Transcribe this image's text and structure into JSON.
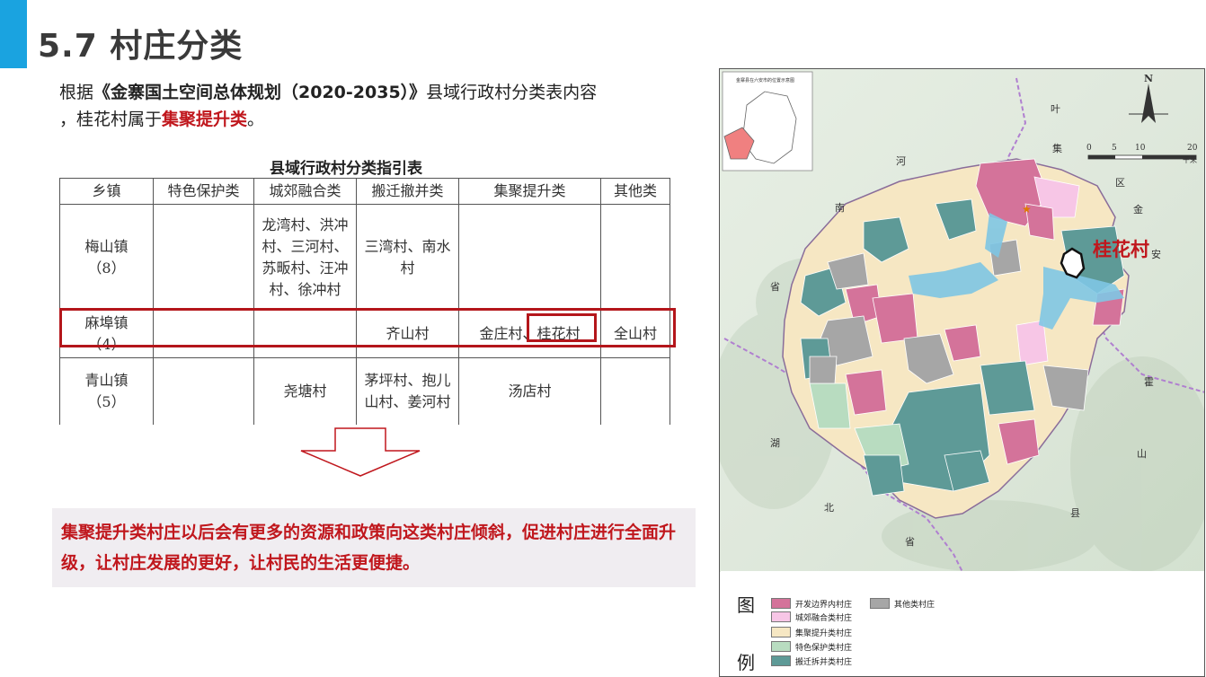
{
  "header": {
    "title": "5.7 村庄分类"
  },
  "intro": {
    "prefix": "根据",
    "doc_title": "《金寨国土空间总体规划（2020-2035）》",
    "suffix": "县域行政村分类表内容",
    "line2_prefix": "，桂花村属于",
    "line2_highlight": "集聚提升类",
    "line2_suffix": "。"
  },
  "table": {
    "title": "县域行政村分类指引表",
    "columns": [
      "乡镇",
      "特色保护类",
      "城郊融合类",
      "搬迁撤并类",
      "集聚提升类",
      "其他类"
    ],
    "rows": [
      {
        "town": "梅山镇\n（8）",
        "special": "",
        "suburban": "龙湾村、洪冲村、三河村、苏畈村、汪冲村、徐冲村",
        "relocate": "三湾村、南水村",
        "cluster": "",
        "other": ""
      },
      {
        "town": "麻埠镇\n（4）",
        "special": "",
        "suburban": "",
        "relocate": "齐山村",
        "cluster": "金庄村、桂花村",
        "other": "全山村"
      },
      {
        "town": "青山镇\n（5）",
        "special": "",
        "suburban": "尧塘村",
        "relocate": "茅坪村、抱儿山村、姜河村",
        "cluster": "汤店村",
        "other": ""
      }
    ]
  },
  "conclusion": "集聚提升类村庄以后会有更多的资源和政策向这类村庄倾斜，促进村庄进行全面升级，让村庄发展的更好，让村民的生活更便捷。",
  "map": {
    "highlight_label": "桂花村",
    "inset_title": "金寨县在六安市的位置示意图",
    "north": "N",
    "scale": {
      "ticks": [
        "0",
        "5",
        "10",
        "20"
      ],
      "unit": "千米"
    },
    "place_labels": {
      "ye": "叶",
      "ji": "集",
      "qu": "区",
      "jin": "金",
      "an": "安",
      "he": "河",
      "nan": "南",
      "sheng1": "省",
      "hu": "湖",
      "bei": "北",
      "sheng2": "省",
      "huo": "霍",
      "shan": "山",
      "xian": "县"
    }
  },
  "legend": {
    "title_1": "图",
    "title_2": "例",
    "items": [
      {
        "label": "开发边界内村庄",
        "color": "#d4739a"
      },
      {
        "label": "城郊融合类村庄",
        "color": "#f7c6e6"
      },
      {
        "label": "集聚提升类村庄",
        "color": "#f6e7c3"
      },
      {
        "label": "特色保护类村庄",
        "color": "#b8dcc0"
      },
      {
        "label": "搬迁拆并类村庄",
        "color": "#5e9a97"
      },
      {
        "label": "其他类村庄",
        "color": "#a6a6a6"
      }
    ]
  }
}
